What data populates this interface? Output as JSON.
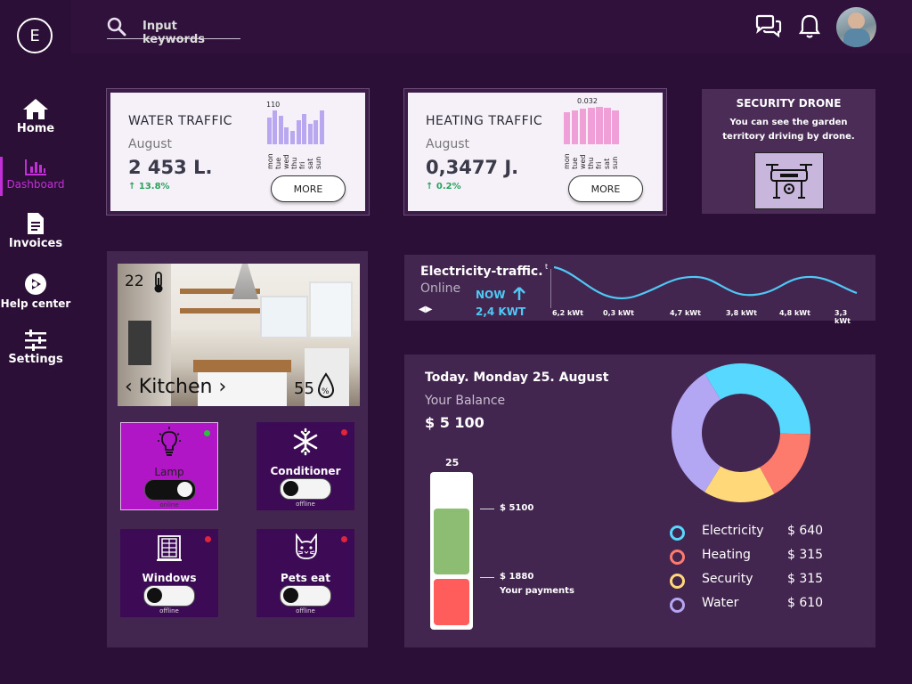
{
  "sidebar": {
    "logo_letter": "E",
    "items": [
      {
        "label": "Home",
        "icon": "home-icon"
      },
      {
        "label": "Dashboard",
        "icon": "bar-chart-icon"
      },
      {
        "label": "Invoices",
        "icon": "document-icon"
      },
      {
        "label": "Help center",
        "icon": "help-play-icon"
      },
      {
        "label": "Settings",
        "icon": "sliders-icon"
      }
    ]
  },
  "header": {
    "search_placeholder": "Input keywords"
  },
  "water": {
    "title": "WATER TRAFFIC",
    "month": "August",
    "value": "2 453 L.",
    "change": "13.8%",
    "peak_label": "110",
    "days": [
      "mon",
      "tue",
      "wed",
      "thu",
      "fri",
      "sat",
      "sun"
    ],
    "bars": [
      0.8,
      1.0,
      0.85,
      0.5,
      0.4,
      0.7,
      0.9,
      0.6,
      0.7,
      1.0
    ],
    "more": "MORE",
    "color": "#b9a8f0"
  },
  "heating": {
    "title": "HEATING TRAFFIC",
    "month": "August",
    "value": "0,3477 J.",
    "change": "0.2%",
    "peak_label": "0.032",
    "days": [
      "mon",
      "tue",
      "wed",
      "thu",
      "fri",
      "sat",
      "sun"
    ],
    "bars": [
      0.85,
      0.9,
      0.95,
      0.97,
      1.0,
      0.98,
      0.9
    ],
    "more": "MORE",
    "color": "#f0a0d6"
  },
  "drone": {
    "title": "SECURITY DRONE",
    "description": "You can see the garden territory driving by drone."
  },
  "kitchen": {
    "room": "Kitchen",
    "temperature": "22",
    "humidity": "55"
  },
  "devices": [
    {
      "name": "Lamp",
      "status": "online",
      "on": true,
      "dot": "#29c23a",
      "icon": "lightbulb-icon"
    },
    {
      "name": "Conditioner",
      "status": "offline",
      "on": false,
      "dot": "#e0243b",
      "icon": "snowflake-icon"
    },
    {
      "name": "Windows",
      "status": "offline",
      "on": false,
      "dot": "#e0243b",
      "icon": "window-icon"
    },
    {
      "name": "Pets eat",
      "status": "offline",
      "on": false,
      "dot": "#e0243b",
      "icon": "cat-icon"
    }
  ],
  "electricity": {
    "title": "Electricity-traffic.",
    "status": "Online",
    "now_label": "NOW",
    "now_value": "2,4 KWT",
    "y_label": "t",
    "x_labels": [
      "6,2 kWt",
      "0,3 kWt",
      "4,7 kWt",
      "3,8 kWt",
      "4,8 kWt",
      "3,3 kWt"
    ]
  },
  "balance": {
    "date": "Today. Monday 25. August",
    "label": "Your Balance",
    "amount": "$ 5 100",
    "meter_top": "25",
    "meter_balance": "$ 5100",
    "meter_payment": "$ 1880",
    "meter_payment_label": "Your payments",
    "meter_green": "#8dbd72",
    "meter_red": "#ff5c5c"
  },
  "chart_data": {
    "type": "pie",
    "categories": [
      "Electricity",
      "Heating",
      "Security",
      "Water"
    ],
    "values": [
      640,
      315,
      315,
      610
    ],
    "labels": [
      "$ 640",
      "$ 315",
      "$ 315",
      "$ 610"
    ],
    "colors": [
      "#56d8ff",
      "#fd7b6c",
      "#ffd87a",
      "#b3a6f3"
    ]
  }
}
